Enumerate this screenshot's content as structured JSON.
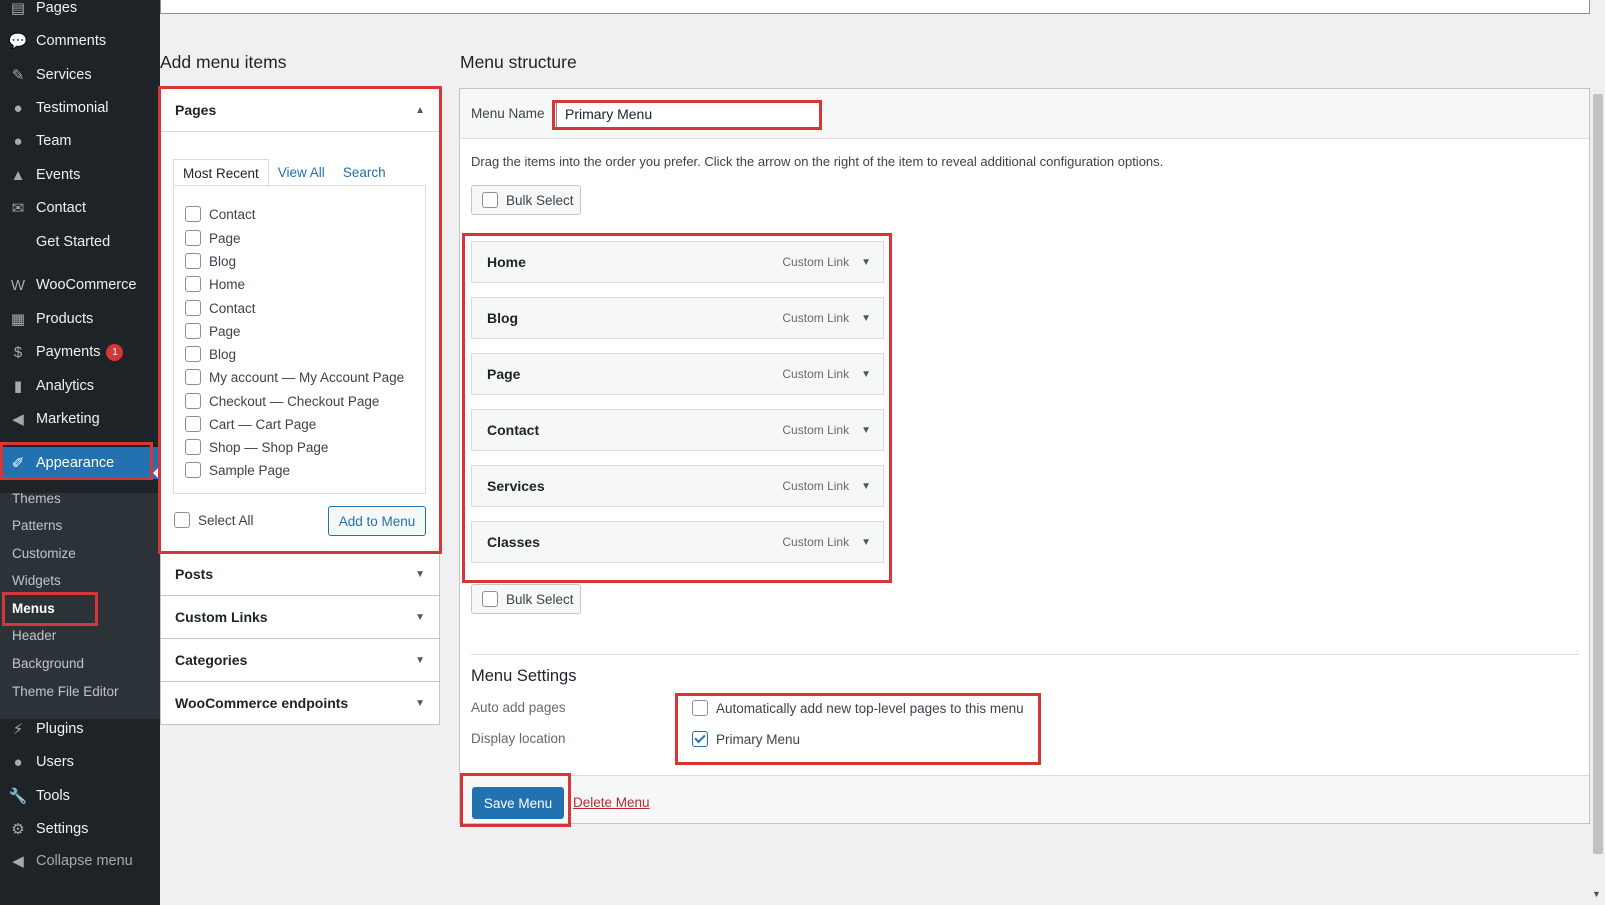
{
  "sidebar": {
    "items": [
      {
        "label": "Pages",
        "icon": "pages-icon",
        "glyph": "▤"
      },
      {
        "label": "Comments",
        "icon": "comments-icon",
        "glyph": "💬"
      },
      {
        "label": "Services",
        "icon": "tag-icon",
        "glyph": "✎"
      },
      {
        "label": "Testimonial",
        "icon": "user-icon",
        "glyph": "●"
      },
      {
        "label": "Team",
        "icon": "user-icon",
        "glyph": "●"
      },
      {
        "label": "Events",
        "icon": "graduation-cap-icon",
        "glyph": "▲"
      },
      {
        "label": "Contact",
        "icon": "email-icon",
        "glyph": "✉"
      },
      {
        "label": "Get Started",
        "icon": "",
        "glyph": ""
      },
      {
        "label": "WooCommerce",
        "icon": "woocommerce-icon",
        "glyph": "W"
      },
      {
        "label": "Products",
        "icon": "archive-icon",
        "glyph": "▦"
      },
      {
        "label": "Payments",
        "icon": "dollar-icon",
        "glyph": "$",
        "badge": "1"
      },
      {
        "label": "Analytics",
        "icon": "bar-chart-icon",
        "glyph": "▮"
      },
      {
        "label": "Marketing",
        "icon": "megaphone-icon",
        "glyph": "◀"
      },
      {
        "label": "Appearance",
        "icon": "paintbrush-icon",
        "glyph": "✐"
      }
    ],
    "submenu": [
      "Themes",
      "Patterns",
      "Customize",
      "Widgets",
      "Menus",
      "Header",
      "Background",
      "Theme File Editor"
    ],
    "lower": [
      {
        "label": "Plugins",
        "icon": "plugin-icon",
        "glyph": "⚡"
      },
      {
        "label": "Users",
        "icon": "users-icon",
        "glyph": "●"
      },
      {
        "label": "Tools",
        "icon": "wrench-icon",
        "glyph": "🔧"
      },
      {
        "label": "Settings",
        "icon": "settings-icon",
        "glyph": "⚙"
      },
      {
        "label": "Collapse menu",
        "icon": "collapse-icon",
        "glyph": "◀"
      }
    ]
  },
  "add_menu_items": {
    "title": "Add menu items",
    "pages_title": "Pages",
    "tabs": [
      "Most Recent",
      "View All",
      "Search"
    ],
    "pages": [
      "Contact",
      "Page",
      "Blog",
      "Home",
      "Contact",
      "Page",
      "Blog",
      {
        "name": "My account",
        "suffix": "My Account Page"
      },
      {
        "name": "Checkout",
        "suffix": "Checkout Page"
      },
      {
        "name": "Cart",
        "suffix": "Cart Page"
      },
      {
        "name": "Shop",
        "suffix": "Shop Page"
      },
      "Sample Page"
    ],
    "select_all": "Select All",
    "add_button": "Add to Menu",
    "other_sections": [
      "Posts",
      "Custom Links",
      "Categories",
      "WooCommerce endpoints"
    ]
  },
  "menu_structure": {
    "title": "Menu structure",
    "name_label": "Menu Name",
    "name_value": "Primary Menu",
    "instructions": "Drag the items into the order you prefer. Click the arrow on the right of the item to reveal additional configuration options.",
    "bulk_select": "Bulk Select",
    "items": [
      {
        "title": "Home",
        "type": "Custom Link"
      },
      {
        "title": "Blog",
        "type": "Custom Link"
      },
      {
        "title": "Page",
        "type": "Custom Link"
      },
      {
        "title": "Contact",
        "type": "Custom Link"
      },
      {
        "title": "Services",
        "type": "Custom Link"
      },
      {
        "title": "Classes",
        "type": "Custom Link"
      }
    ],
    "settings": {
      "title": "Menu Settings",
      "auto_add_label": "Auto add pages",
      "auto_add_option": "Automatically add new top-level pages to this menu",
      "auto_add_checked": false,
      "display_label": "Display location",
      "display_option": "Primary Menu",
      "display_checked": true
    },
    "save_button": "Save Menu",
    "delete_link": "Delete Menu"
  },
  "colors": {
    "accent": "#2271b1",
    "highlight": "#d63638",
    "sidebar_bg": "#1d2327"
  }
}
